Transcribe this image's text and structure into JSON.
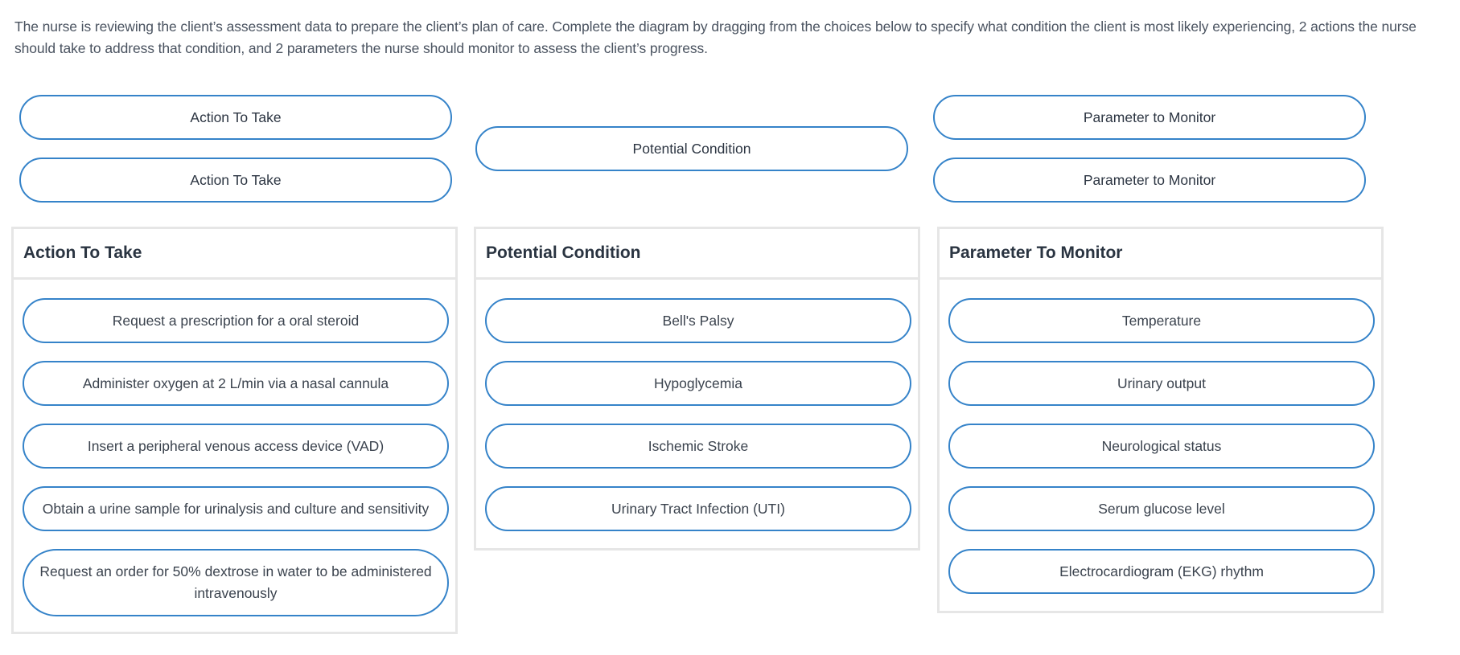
{
  "instructions": "The nurse is reviewing the client’s assessment data to prepare the client’s plan of care. Complete the diagram by dragging from the choices below to specify what condition the client is most likely experiencing, 2 actions the nurse should take to address that condition, and 2 parameters the nurse should monitor to assess the client’s progress.",
  "diagram": {
    "action_slots": [
      "Action To Take",
      "Action To Take"
    ],
    "condition_slot": "Potential Condition",
    "parameter_slots": [
      "Parameter to Monitor",
      "Parameter to Monitor"
    ]
  },
  "panels": {
    "actions": {
      "title": "Action To Take",
      "items": [
        "Request a prescription for a oral steroid",
        "Administer oxygen at 2 L/min via a nasal cannula",
        "Insert a peripheral venous access device (VAD)",
        "Obtain a urine sample for urinalysis and culture and sensitivity",
        "Request an order for 50% dextrose in water to be administered intravenously"
      ]
    },
    "conditions": {
      "title": "Potential Condition",
      "items": [
        "Bell's Palsy",
        "Hypoglycemia",
        "Ischemic Stroke",
        "Urinary Tract Infection (UTI)"
      ]
    },
    "parameters": {
      "title": "Parameter To Monitor",
      "items": [
        "Temperature",
        "Urinary output",
        "Neurological status",
        "Serum glucose level",
        "Electrocardiogram (EKG) rhythm"
      ]
    }
  },
  "colors": {
    "accent": "#3583c9",
    "panel_border": "#e6e6e6",
    "text": "#2c3542"
  }
}
